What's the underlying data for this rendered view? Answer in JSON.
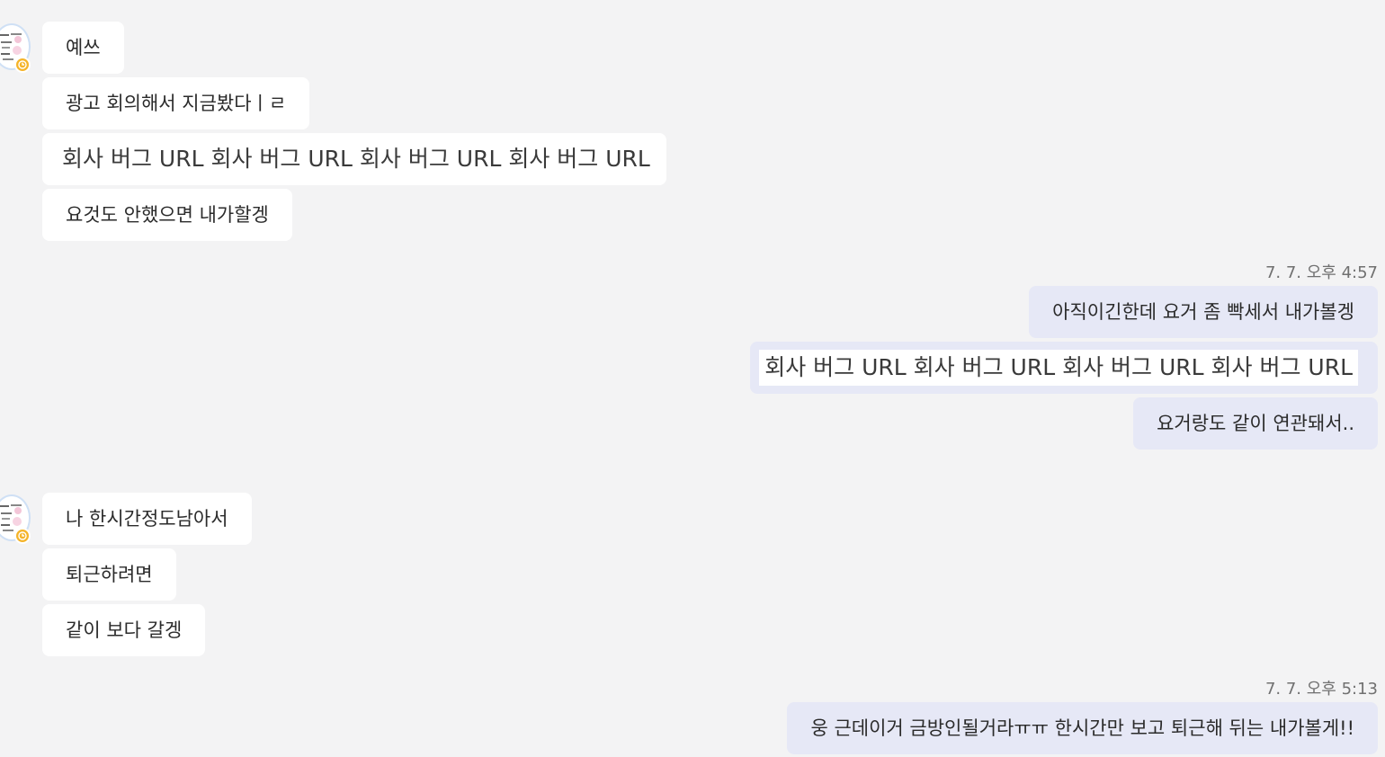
{
  "group1": {
    "messages": [
      "예쓰",
      "광고 회의해서 지금봤다ㅣㄹ",
      "회사 버그 URL 회사 버그 URL 회사 버그 URL 회사 버그 URL",
      "요것도 안했으면 내가할겡"
    ]
  },
  "group2": {
    "timestamp": "7. 7. 오후 4:57",
    "messages": [
      "아직이긴한데 요거 좀 빡세서 내가볼겡",
      "회사 버그 URL 회사 버그 URL 회사 버그 URL 회사 버그 URL",
      "요거랑도 같이 연관돼서.."
    ]
  },
  "group3": {
    "messages": [
      "나 한시간정도남아서",
      "퇴근하려면",
      "같이 보다 갈겡"
    ]
  },
  "group4": {
    "timestamp": "7. 7. 오후 5:13",
    "messages": [
      "웅 근데이거 금방인될거라ㅠㅠ 한시간만 보고 퇴근해 뒤는 내가볼게!!"
    ]
  },
  "colors": {
    "background": "#f3f3f4",
    "incoming_bubble": "#ffffff",
    "outgoing_bubble": "#e6e8f6",
    "status_dot": "#f5b42a"
  },
  "icons": {
    "avatar": "sender-avatar",
    "status": "clock-icon"
  }
}
